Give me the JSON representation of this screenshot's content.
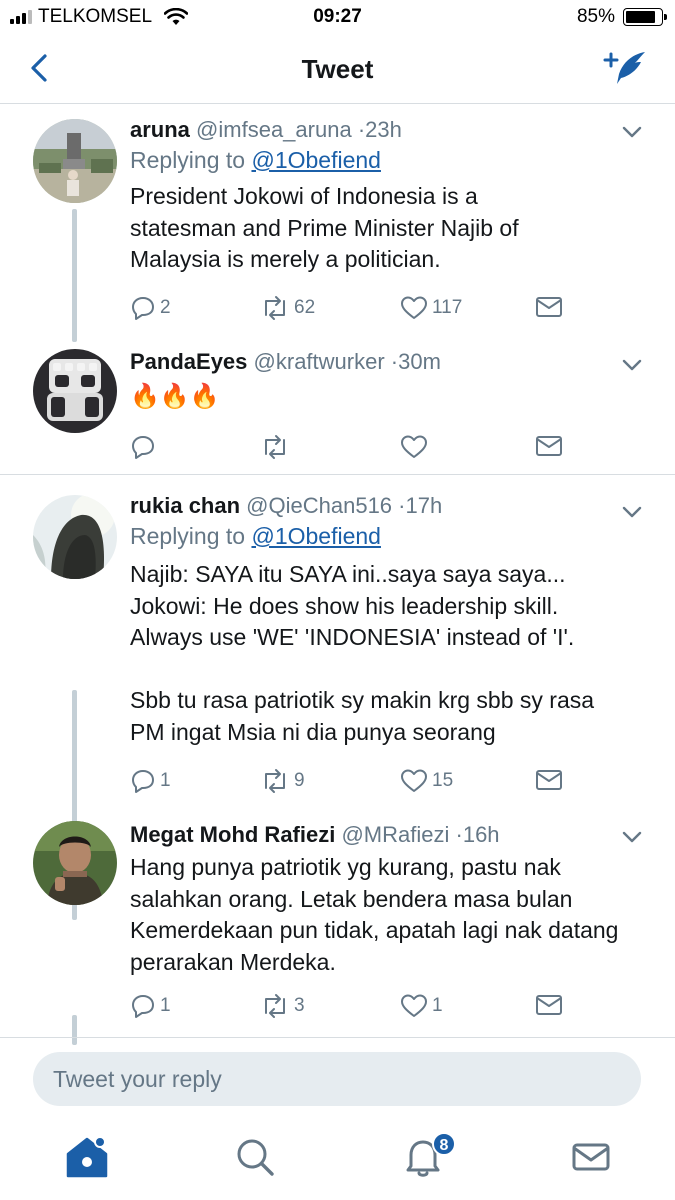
{
  "status_bar": {
    "carrier": "TELKOMSEL",
    "time": "09:27",
    "battery_percent": "85%",
    "battery_level": 0.85
  },
  "nav": {
    "title": "Tweet",
    "back_icon": "chevron-left-icon",
    "compose_icon": "compose-tweet-icon"
  },
  "tweets": [
    {
      "name": "aruna",
      "handle": "@imfsea_aruna",
      "time": "23h",
      "replying_prefix": "Replying to",
      "replying_to": "@1Obefiend",
      "text": "President Jokowi of Indonesia is a statesman and Prime Minister Najib of Malaysia is merely a politician.",
      "replies": "2",
      "retweets": "62",
      "likes": "117"
    },
    {
      "name": "PandaEyes",
      "handle": "@kraftwurker",
      "time": "30m",
      "text": "🔥🔥🔥",
      "replies": "",
      "retweets": "",
      "likes": ""
    },
    {
      "name": "rukia chan",
      "handle": "@QieChan516",
      "time": "17h",
      "replying_prefix": "Replying to",
      "replying_to": "@1Obefiend",
      "text": "Najib: SAYA itu SAYA ini..saya saya saya...\nJokowi: He does show his leadership skill.\nAlways use 'WE' 'INDONESIA' instead of 'I'.\n\nSbb tu rasa patriotik sy makin krg sbb sy rasa PM ingat Msia ni dia punya seorang",
      "replies": "1",
      "retweets": "9",
      "likes": "15"
    },
    {
      "name": "Megat Mohd Rafiezi",
      "handle": "@MRafiezi",
      "time": "16h",
      "text": "Hang punya patriotik yg kurang, pastu nak salahkan orang. Letak bendera masa bulan Kemerdekaan pun tidak, apatah lagi nak datang perarakan Merdeka.",
      "replies": "1",
      "retweets": "3",
      "likes": "1"
    }
  ],
  "separator": "·",
  "reply_box": {
    "placeholder": "Tweet your reply"
  },
  "tab_bar": {
    "notifications_badge": "8",
    "icons": [
      "home-icon",
      "search-icon",
      "notifications-icon",
      "messages-icon"
    ]
  },
  "colors": {
    "accent": "#1b5fa8",
    "secondary_text": "#657786",
    "thread_line": "#c4cfd6",
    "reply_box_bg": "#e6ecf0"
  }
}
